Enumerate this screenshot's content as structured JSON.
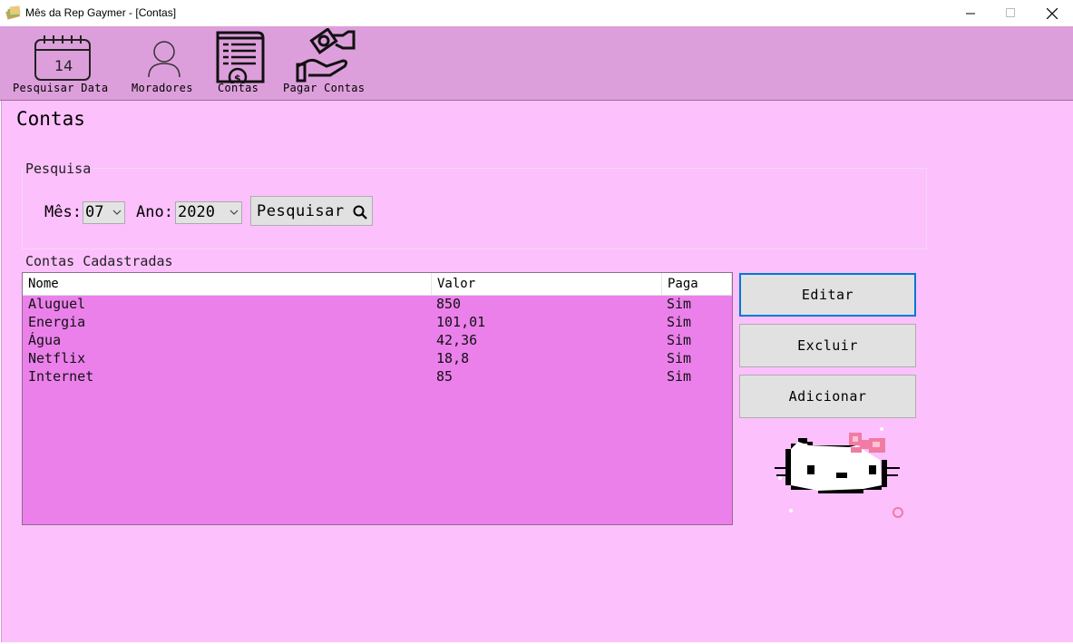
{
  "window": {
    "title": "Mês da Rep Gaymer - [Contas]",
    "controls": {
      "minimize": "—",
      "maximize": "☐",
      "close": "✕"
    }
  },
  "toolbar": {
    "items": [
      {
        "label": "Pesquisar Data",
        "icon": "calendar-icon"
      },
      {
        "label": "Moradores",
        "icon": "user-icon"
      },
      {
        "label": "Contas",
        "icon": "bill-icon"
      },
      {
        "label": "Pagar Contas",
        "icon": "pay-hand-icon"
      }
    ]
  },
  "page": {
    "title": "Contas"
  },
  "search": {
    "group_label": "Pesquisa",
    "month_label": "Mês:",
    "month_value": "07",
    "year_label": "Ano:",
    "year_value": "2020",
    "button_label": "Pesquisar"
  },
  "bills": {
    "group_label": "Contas Cadastradas",
    "columns": [
      "Nome",
      "Valor",
      "Paga"
    ],
    "rows": [
      [
        "Aluguel",
        "850",
        "Sim"
      ],
      [
        "Energia",
        "101,01",
        "Sim"
      ],
      [
        "Água",
        "42,36",
        "Sim"
      ],
      [
        "Netflix",
        "18,8",
        "Sim"
      ],
      [
        "Internet",
        "85",
        "Sim"
      ]
    ]
  },
  "actions": {
    "edit": "Editar",
    "delete": "Excluir",
    "add": "Adicionar"
  },
  "colors": {
    "toolbar_bg": "#dd9fdb",
    "content_bg": "#fcc0fc",
    "list_bg": "#eb80eb",
    "focus": "#0078d7"
  },
  "decoration": {
    "image": "hello-kitty-pixel-art"
  }
}
